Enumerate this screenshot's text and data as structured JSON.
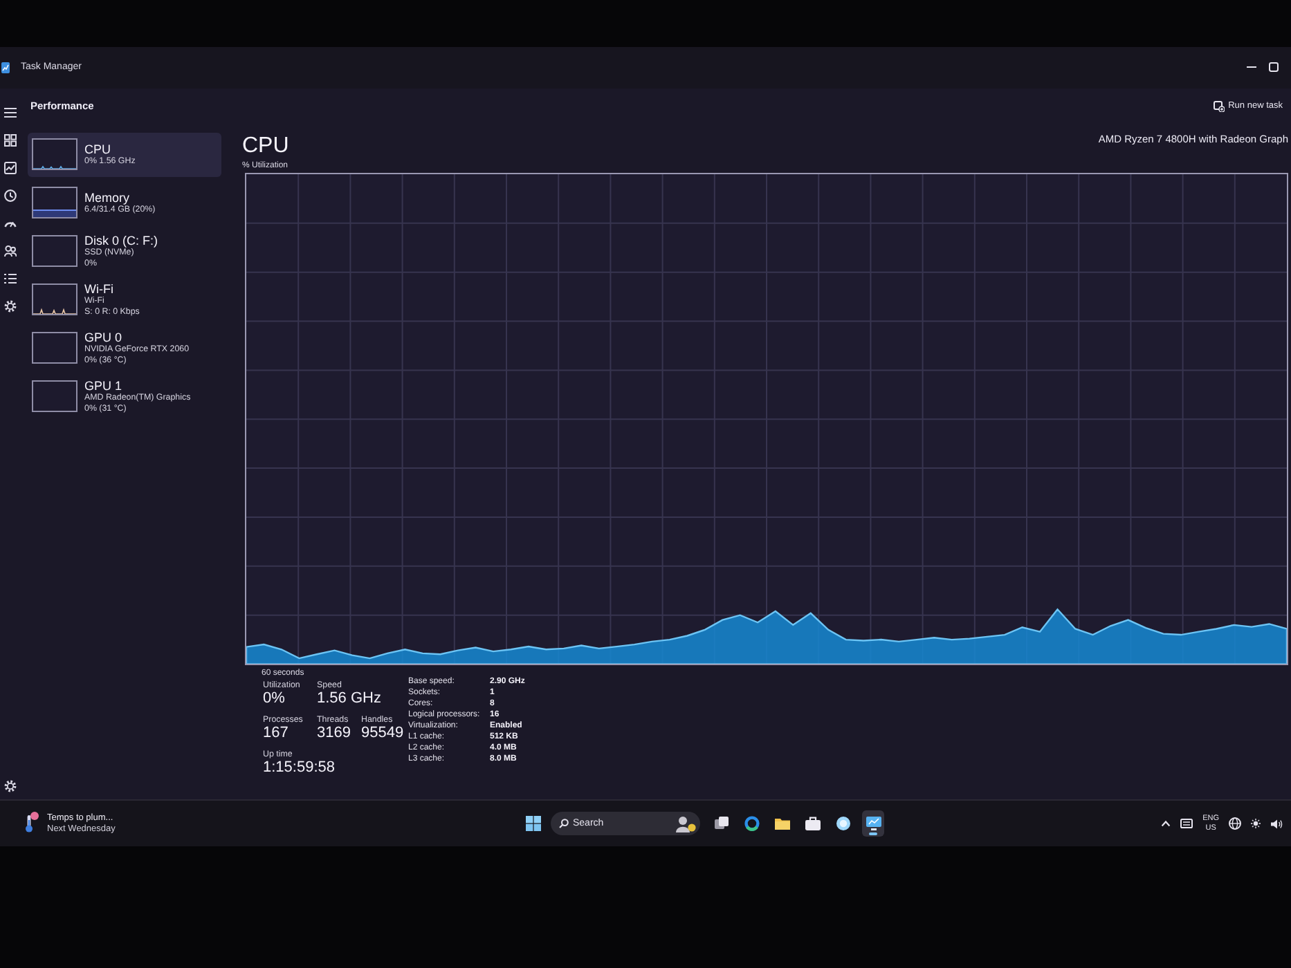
{
  "window": {
    "title": "Task Manager",
    "page_title": "Performance",
    "run_new_task": "Run new task"
  },
  "devices": [
    {
      "kind": "cpu",
      "name": "CPU",
      "details": [
        "0% 1.56 GHz"
      ],
      "selected": true
    },
    {
      "kind": "memory",
      "name": "Memory",
      "details": [
        "6.4/31.4 GB (20%)"
      ],
      "selected": false
    },
    {
      "kind": "disk",
      "name": "Disk 0 (C: F:)",
      "details": [
        "SSD (NVMe)",
        "0%"
      ],
      "selected": false
    },
    {
      "kind": "network",
      "name": "Wi-Fi",
      "details": [
        "Wi-Fi",
        "S: 0 R: 0 Kbps"
      ],
      "selected": false
    },
    {
      "kind": "gpu",
      "name": "GPU 0",
      "details": [
        "NVIDIA GeForce RTX 2060",
        "0% (36 °C)"
      ],
      "selected": false
    },
    {
      "kind": "gpu",
      "name": "GPU 1",
      "details": [
        "AMD Radeon(TM) Graphics",
        "0% (31 °C)"
      ],
      "selected": false
    }
  ],
  "detail": {
    "title": "CPU",
    "model": "AMD Ryzen 7 4800H with Radeon Graph",
    "graph_label": "% Utilization",
    "time_span": "60 seconds",
    "stats": [
      [
        {
          "label": "Utilization",
          "value": "0%"
        },
        {
          "label": "Speed",
          "value": "1.56 GHz"
        }
      ],
      [
        {
          "label": "Processes",
          "value": "167"
        },
        {
          "label": "Threads",
          "value": "3169"
        },
        {
          "label": "Handles",
          "value": "95549"
        }
      ],
      [
        {
          "label": "Up time",
          "value": "1:15:59:58"
        }
      ]
    ],
    "specs": [
      {
        "label": "Base speed:",
        "value": "2.90 GHz"
      },
      {
        "label": "Sockets:",
        "value": "1"
      },
      {
        "label": "Cores:",
        "value": "8"
      },
      {
        "label": "Logical processors:",
        "value": "16"
      },
      {
        "label": "Virtualization:",
        "value": "Enabled"
      },
      {
        "label": "L1 cache:",
        "value": "512 KB"
      },
      {
        "label": "L2 cache:",
        "value": "4.0 MB"
      },
      {
        "label": "L3 cache:",
        "value": "8.0 MB"
      }
    ]
  },
  "taskbar": {
    "weather": {
      "headline": "Temps to plum...",
      "subtitle": "Next Wednesday"
    },
    "search": {
      "placeholder": "Search"
    },
    "apps": [
      {
        "kind": "taskview",
        "running": false
      },
      {
        "kind": "browser",
        "running": false
      },
      {
        "kind": "folder",
        "running": false
      },
      {
        "kind": "bag",
        "running": false
      },
      {
        "kind": "orb",
        "running": false
      },
      {
        "kind": "monitor",
        "running": true
      }
    ],
    "language": "ENG",
    "region": "US"
  }
}
